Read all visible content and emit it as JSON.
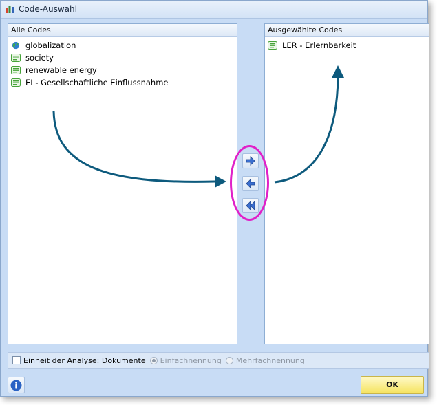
{
  "window": {
    "title": "Code-Auswahl",
    "title_icon": "bar-chart-icon"
  },
  "left_panel": {
    "header": "Alle Codes",
    "items": [
      {
        "label": "globalization",
        "icon": "globe-icon"
      },
      {
        "label": "society",
        "icon": "code-tag-icon"
      },
      {
        "label": "renewable energy",
        "icon": "code-tag-icon"
      },
      {
        "label": "EI - Gesellschaftliche Einflussnahme",
        "icon": "code-tag-icon"
      }
    ]
  },
  "right_panel": {
    "header": "Ausgewählte Codes",
    "items": [
      {
        "label": "LER - Erlernbarkeit",
        "icon": "code-tag-icon"
      }
    ]
  },
  "transfer_buttons": [
    {
      "name": "move-right",
      "icon": "arrow-right-icon"
    },
    {
      "name": "move-left",
      "icon": "arrow-left-icon"
    },
    {
      "name": "move-all-left",
      "icon": "double-arrow-left-icon"
    }
  ],
  "options": {
    "unit_checkbox_label": "Einheit der Analyse: Dokumente",
    "unit_checked": false,
    "radio_single": "Einfachnennung",
    "radio_multiple": "Mehrfachnennung",
    "selected_radio": "Einfachnennung"
  },
  "footer": {
    "info_icon": "info-icon",
    "ok_label": "OK"
  },
  "colors": {
    "window_bg": "#c8dcf5",
    "annotation_arrow": "#0d5a7d",
    "highlight_ring": "#e020c8",
    "ok_button": "#f5e35f"
  }
}
